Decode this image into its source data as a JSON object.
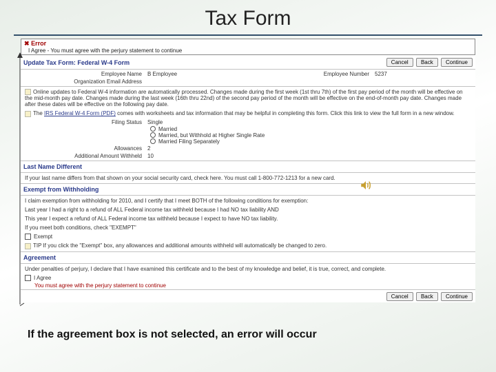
{
  "slide": {
    "title": "Tax Form",
    "caption": "If the agreement box is not selected, an error will occur"
  },
  "error": {
    "label": "Error",
    "message": "I Agree - You must agree with the perjury statement to continue"
  },
  "form": {
    "title": "Update Tax Form: Federal W-4 Form",
    "buttons": {
      "cancel": "Cancel",
      "back": "Back",
      "continue": "Continue"
    },
    "employee_name_label": "Employee Name",
    "employee_name_value": "B Employee",
    "employee_number_label": "Employee Number",
    "employee_number_value": "5237",
    "org_email_label": "Organization Email Address",
    "note1": "Online updates to Federal W-4 information are automatically processed. Changes made during the first week (1st thru 7th) of the first pay period of the month will be effective on the mid-month pay date. Changes made during the last week (16th thru 22nd) of the second pay period of the month will be effective on the end-of-month pay date. Changes made after these dates will be effective on the following pay date.",
    "note2a": "The ",
    "note2link": "IRS Federal W-4 Form (PDF)",
    "note2b": " comes with worksheets and tax information that may be helpful in completing this form. Click this link to view the full form in a new window.",
    "filing_status_label": "Filing Status",
    "filing_options": [
      "Single",
      "Married",
      "Married, but Withhold at Higher Single Rate",
      "Married Filing Separately"
    ],
    "allowances_label": "Allowances",
    "allowances_value": "2",
    "additional_label": "Additional Amount Withheld",
    "additional_value": "10"
  },
  "lastname": {
    "title": "Last Name Different",
    "text": "If your last name differs from that shown on your social security card, check here. You must call 1-800-772-1213 for a new card."
  },
  "exempt": {
    "title": "Exempt from Withholding",
    "line1": "I claim exemption from withholding for 2010, and I certify that I meet BOTH of the following conditions for exemption:",
    "line2": "Last year I had a right to a refund of ALL Federal income tax withheld because I had NO tax liability AND",
    "line3": "This year I expect a refund of ALL Federal income tax withheld because I expect to have NO tax liability.",
    "line4": "If you meet both conditions, check \"EXEMPT\"",
    "checkbox_label": "Exempt",
    "tip": "TIP If you click the \"Exempt\" box, any allowances and additional amounts withheld will automatically be changed to zero."
  },
  "agreement": {
    "title": "Agreement",
    "text": "Under penalties of perjury, I declare that I have examined this certificate and to the best of my knowledge and belief, it is true, correct, and complete.",
    "checkbox_label": "I Agree",
    "warn": "You must agree with the perjury statement to continue"
  }
}
